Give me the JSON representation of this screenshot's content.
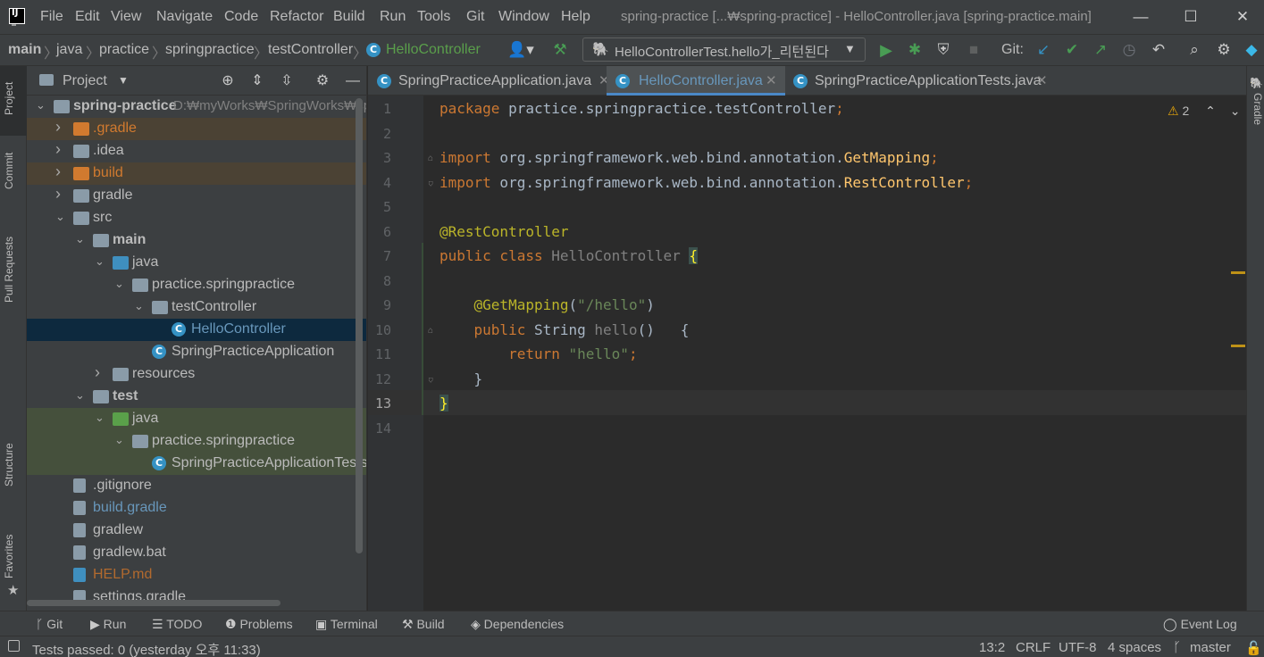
{
  "menu": [
    "File",
    "Edit",
    "View",
    "Navigate",
    "Code",
    "Refactor",
    "Build",
    "Run",
    "Tools",
    "Git",
    "Window",
    "Help"
  ],
  "window_title": "spring-practice [...₩spring-practice] - HelloController.java [spring-practice.main]",
  "window_controls": {
    "minimize": "—",
    "maximize": "☐",
    "close": "✕"
  },
  "breadcrumbs": [
    "main",
    "java",
    "practice",
    "springpractice",
    "testController",
    "HelloController"
  ],
  "run_config": "HelloControllerTest.hello가_리턴된다",
  "git_label": "Git:",
  "project_panel": {
    "title": "Project",
    "tree": [
      {
        "label": "spring-practice",
        "extra": "D:₩myWorks₩SpringWorks₩spr",
        "depth": 0,
        "arrow": "open",
        "icon": "module-folder",
        "bold": true
      },
      {
        "label": ".gradle",
        "depth": 1,
        "arrow": "closed",
        "icon": "excluded-folder",
        "highlight": "excluded"
      },
      {
        "label": ".idea",
        "depth": 1,
        "arrow": "closed",
        "icon": "folder"
      },
      {
        "label": "build",
        "depth": 1,
        "arrow": "closed",
        "icon": "excluded-folder",
        "highlight": "excluded"
      },
      {
        "label": "gradle",
        "depth": 1,
        "arrow": "closed",
        "icon": "folder"
      },
      {
        "label": "src",
        "depth": 1,
        "arrow": "open",
        "icon": "folder"
      },
      {
        "label": "main",
        "depth": 2,
        "arrow": "open",
        "icon": "module-folder",
        "bold": true
      },
      {
        "label": "java",
        "depth": 3,
        "arrow": "open",
        "icon": "source-folder"
      },
      {
        "label": "practice.springpractice",
        "depth": 4,
        "arrow": "open",
        "icon": "package"
      },
      {
        "label": "testController",
        "depth": 5,
        "arrow": "open",
        "icon": "package"
      },
      {
        "label": "HelloController",
        "depth": 6,
        "arrow": "none",
        "icon": "class",
        "selected": true
      },
      {
        "label": "SpringPracticeApplication",
        "depth": 5,
        "arrow": "none",
        "icon": "spring-class"
      },
      {
        "label": "resources",
        "depth": 3,
        "arrow": "closed",
        "icon": "resources-folder"
      },
      {
        "label": "test",
        "depth": 2,
        "arrow": "open",
        "icon": "module-folder",
        "bold": true
      },
      {
        "label": "java",
        "depth": 3,
        "arrow": "open",
        "icon": "test-folder",
        "highlight": "test"
      },
      {
        "label": "practice.springpractice",
        "depth": 4,
        "arrow": "open",
        "icon": "package",
        "highlight": "test"
      },
      {
        "label": "SpringPracticeApplicationTests",
        "depth": 5,
        "arrow": "none",
        "icon": "spring-class",
        "highlight": "test"
      },
      {
        "label": ".gitignore",
        "depth": 1,
        "arrow": "none",
        "icon": "file"
      },
      {
        "label": "build.gradle",
        "depth": 1,
        "arrow": "none",
        "icon": "gradle-file",
        "color": "#6897bb"
      },
      {
        "label": "gradlew",
        "depth": 1,
        "arrow": "none",
        "icon": "shell-file"
      },
      {
        "label": "gradlew.bat",
        "depth": 1,
        "arrow": "none",
        "icon": "file"
      },
      {
        "label": "HELP.md",
        "depth": 1,
        "arrow": "none",
        "icon": "md-file",
        "color": "#b26a2e"
      },
      {
        "label": "settings.gradle",
        "depth": 1,
        "arrow": "none",
        "icon": "gradle-file"
      }
    ]
  },
  "left_stripe": [
    "Project",
    "Commit",
    "Pull Requests",
    "Structure",
    "Favorites"
  ],
  "right_stripe": [
    "Gradle"
  ],
  "editor": {
    "tabs": [
      {
        "label": "SpringPracticeApplication.java",
        "active": false
      },
      {
        "label": "HelloController.java",
        "active": true
      },
      {
        "label": "SpringPracticeApplicationTests.java",
        "active": false
      }
    ],
    "line_numbers": [
      "1",
      "2",
      "3",
      "4",
      "5",
      "6",
      "7",
      "8",
      "9",
      "10",
      "11",
      "12",
      "13",
      "14"
    ],
    "current_line": "13",
    "warnings": "2"
  },
  "bottom_tools": [
    "Git",
    "Run",
    "TODO",
    "Problems",
    "Terminal",
    "Build",
    "Dependencies"
  ],
  "event_log": "Event Log",
  "status": {
    "message": "Tests passed: 0 (yesterday 오후 11:33)",
    "position": "13:2",
    "line_sep": "CRLF",
    "encoding": "UTF-8",
    "indent": "4 spaces",
    "branch": "master"
  },
  "colors": {
    "accent": "#4a88c7",
    "keyword": "#cc7832",
    "annotation": "#bbb529",
    "string": "#6a8759",
    "class": "#3592c4"
  }
}
